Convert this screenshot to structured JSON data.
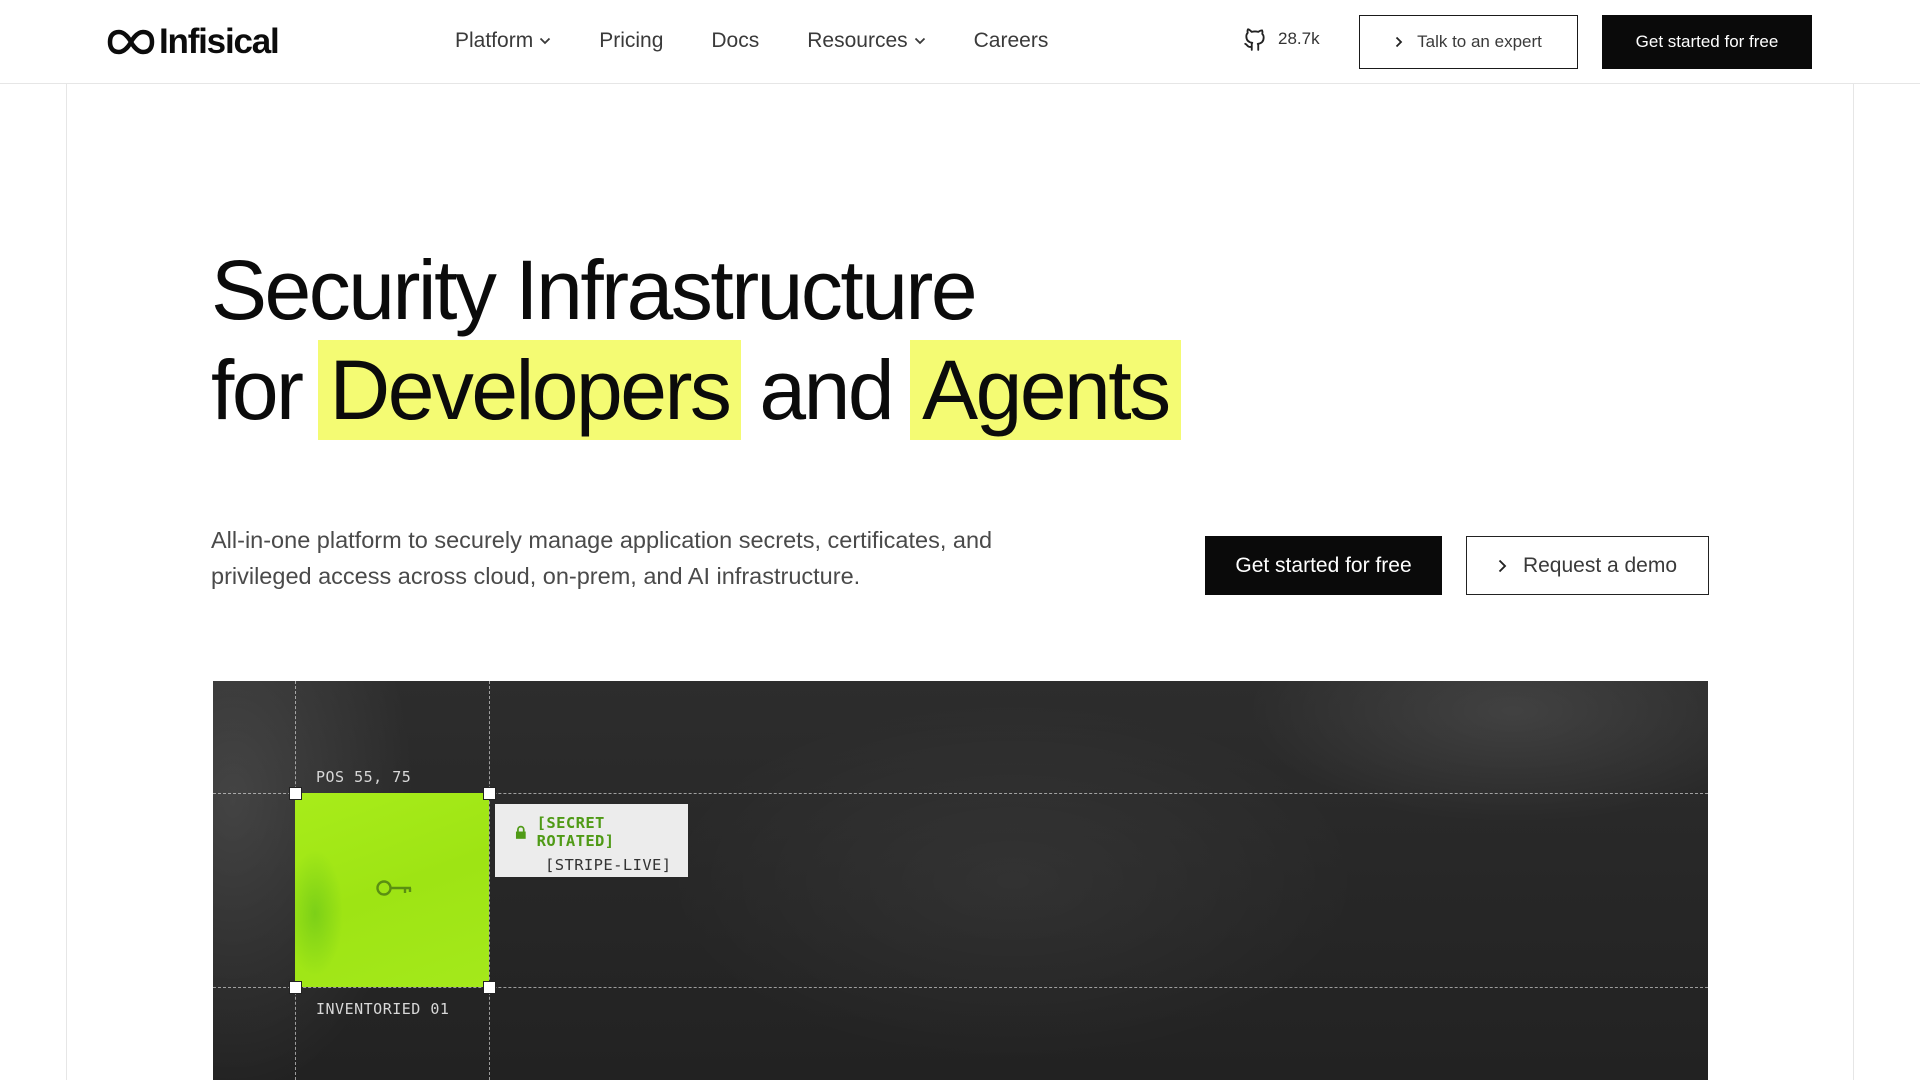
{
  "header": {
    "brand": "Infisical",
    "nav": [
      {
        "label": "Platform",
        "has_dropdown": true
      },
      {
        "label": "Pricing",
        "has_dropdown": false
      },
      {
        "label": "Docs",
        "has_dropdown": false
      },
      {
        "label": "Resources",
        "has_dropdown": true
      },
      {
        "label": "Careers",
        "has_dropdown": false
      }
    ],
    "github_stars": "28.7k",
    "talk_button": "Talk to an expert",
    "get_started_button": "Get started for free"
  },
  "hero": {
    "title_line1": "Security Infrastructure",
    "title_for": "for",
    "title_highlight1": "Developers",
    "title_and": "and",
    "title_highlight2": "Agents",
    "highlight_color": "#f4fb73",
    "lead": "All-in-one platform to securely manage application secrets, certificates, and privileged access across cloud, on-prem, and AI infrastructure.",
    "cta_primary": "Get started for free",
    "cta_secondary": "Request a demo"
  },
  "visual": {
    "pos_label": "POS 55, 75",
    "inventory_label": "INVENTORIED 01",
    "tag_status": "[SECRET ROTATED]",
    "tag_name": "[STRIPE-LIVE]",
    "accent_green": "#a4e91b"
  },
  "icons": {
    "logo": "infinity-icon",
    "github": "github-icon",
    "chevron": "chevron-down-icon",
    "arrow": "chevron-right-icon",
    "lock": "lock-icon",
    "key": "key-icon"
  }
}
